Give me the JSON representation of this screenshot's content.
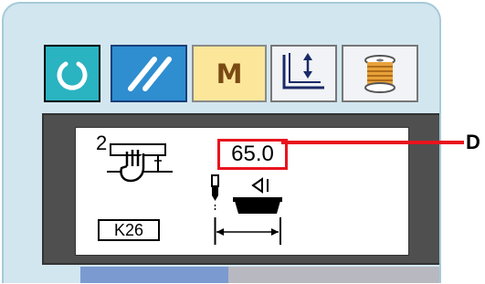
{
  "toolbar": {
    "reset_icon": "circular-arrow-icon",
    "clear_icon": "double-slash-icon",
    "mode_label": "M",
    "thread_guide_icon": "presser-updown-icon",
    "bobbin_icon": "bobbin-winder-icon"
  },
  "lcd": {
    "param_number": "2",
    "machine_icon": "hand-on-sewing-machine-icon",
    "code": "K26",
    "value": "65.0",
    "distance_icon": "needle-to-bed-distance-icon"
  },
  "callout": {
    "label": "D"
  },
  "colors": {
    "panel_bg": "#d2e6ef",
    "lcd_frame": "#4f4f4f",
    "highlight": "#e8141e",
    "reset_button": "#2ab3c1",
    "clear_button": "#2e8ed0",
    "mode_button": "#fbe69a"
  }
}
